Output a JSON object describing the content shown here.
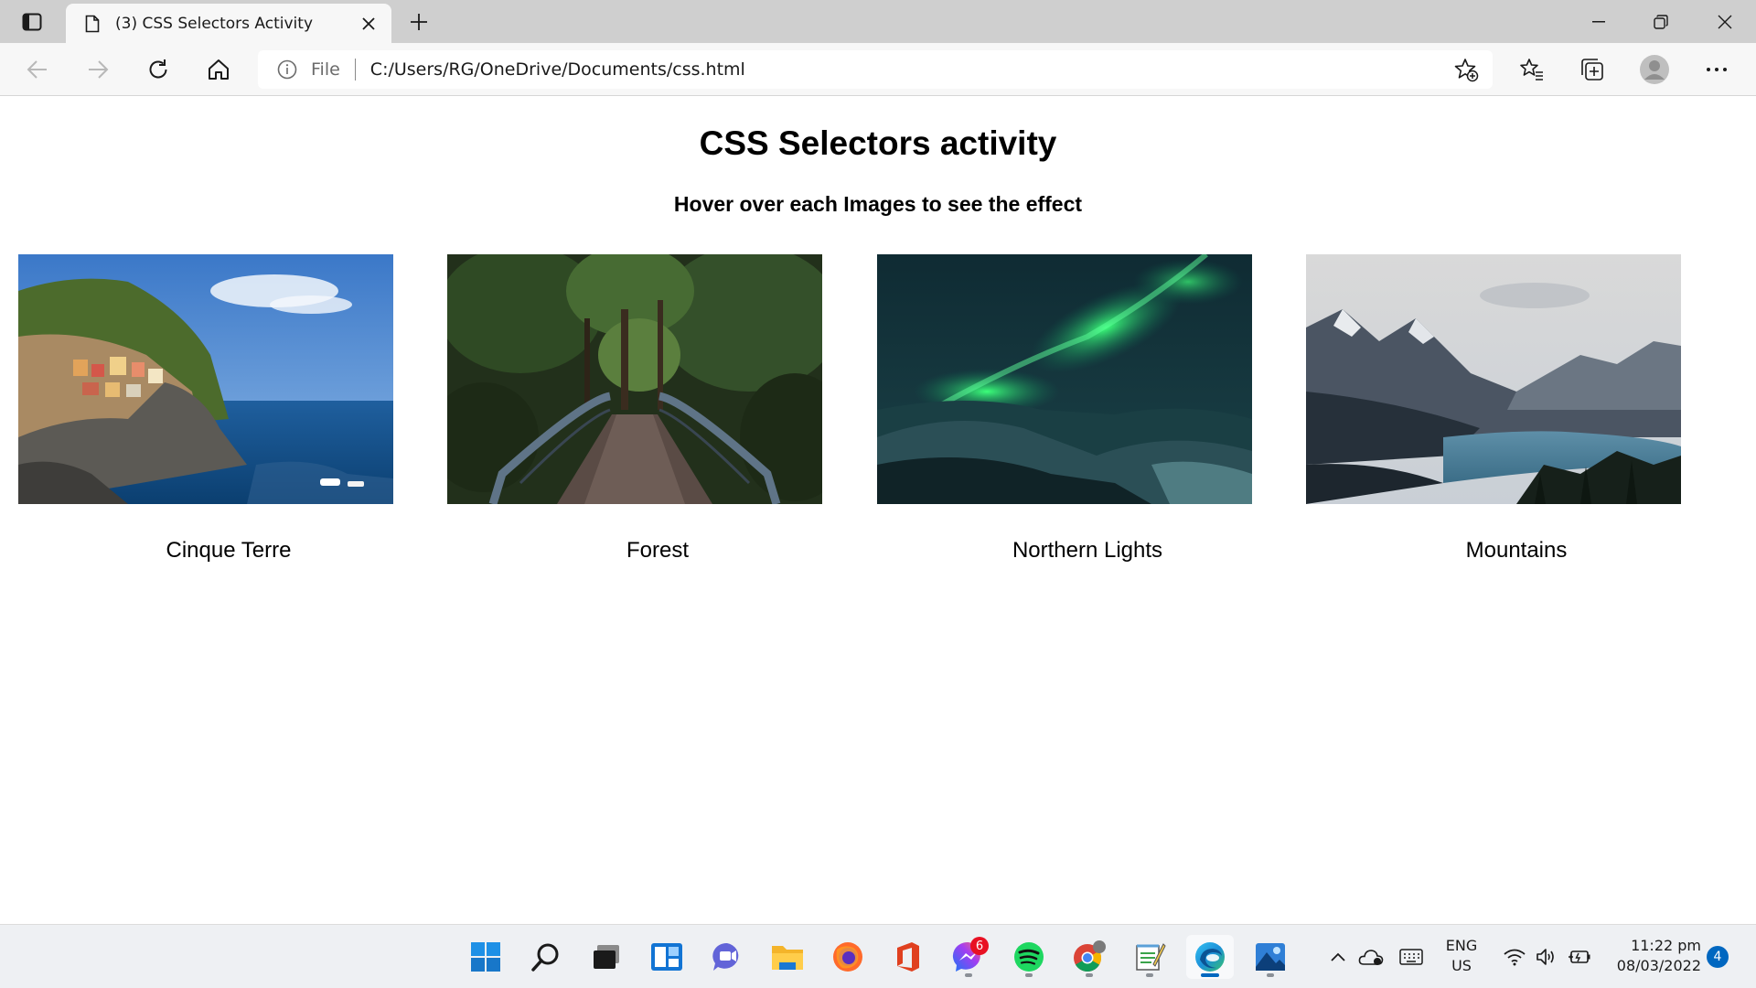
{
  "browser": {
    "tab": {
      "title": "(3) CSS Selectors Activity",
      "icon": "page-icon"
    },
    "address": {
      "scheme": "File",
      "url": "C:/Users/RG/OneDrive/Documents/css.html"
    },
    "toolbar_icons": [
      "back-icon",
      "forward-icon",
      "refresh-icon",
      "home-icon",
      "add-favorite-icon",
      "favorites-icon",
      "collections-icon",
      "profile-icon",
      "more-icon"
    ],
    "window_controls": [
      "minimize-icon",
      "restore-icon",
      "close-icon"
    ]
  },
  "page": {
    "heading": "CSS Selectors activity",
    "subheading": "Hover over each Images to see the effect",
    "cards": [
      {
        "caption": "Cinque Terre",
        "image": "coastal-village-photo"
      },
      {
        "caption": "Forest",
        "image": "forest-bridge-photo"
      },
      {
        "caption": "Northern Lights",
        "image": "aurora-photo"
      },
      {
        "caption": "Mountains",
        "image": "mountain-lake-photo"
      }
    ]
  },
  "taskbar": {
    "apps": [
      "windows-start-icon",
      "search-icon",
      "task-view-icon",
      "widgets-icon",
      "teams-chat-icon",
      "file-explorer-icon",
      "firefox-icon",
      "office-icon",
      "messenger-icon",
      "spotify-icon",
      "chrome-icon",
      "notepad-icon",
      "edge-icon",
      "photos-icon"
    ],
    "messenger_badge": "6",
    "lang_line1": "ENG",
    "lang_line2": "US",
    "time": "11:22 pm",
    "date": "08/03/2022",
    "notification_count": "4"
  }
}
